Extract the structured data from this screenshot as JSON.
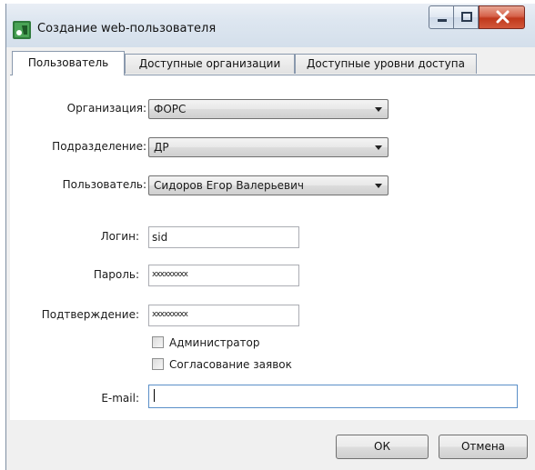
{
  "window": {
    "title": "Создание web-пользователя"
  },
  "tabs": [
    {
      "label": "Пользователь",
      "active": true
    },
    {
      "label": "Доступные организации",
      "active": false
    },
    {
      "label": "Доступные уровни доступа",
      "active": false
    }
  ],
  "form": {
    "organization": {
      "label": "Организация:",
      "value": "ФОРС"
    },
    "department": {
      "label": "Подразделение:",
      "value": "ДР"
    },
    "user": {
      "label": "Пользователь:",
      "value": "Сидоров Егор Валерьевич"
    },
    "login": {
      "label": "Логин:",
      "value": "sid"
    },
    "password": {
      "label": "Пароль:",
      "value": "xxxxxxxxx"
    },
    "confirm": {
      "label": "Подтверждение:",
      "value": "xxxxxxxxx"
    },
    "admin": {
      "label": "Администратор",
      "checked": false
    },
    "approval": {
      "label": "Согласование заявок",
      "checked": false
    },
    "email": {
      "label": "E-mail:",
      "value": ""
    }
  },
  "buttons": {
    "ok": "ОК",
    "cancel": "Отмена"
  },
  "icons": {
    "app": "app-icon",
    "minimize": "minimize-icon",
    "maximize": "maximize-icon",
    "close": "close-icon"
  }
}
